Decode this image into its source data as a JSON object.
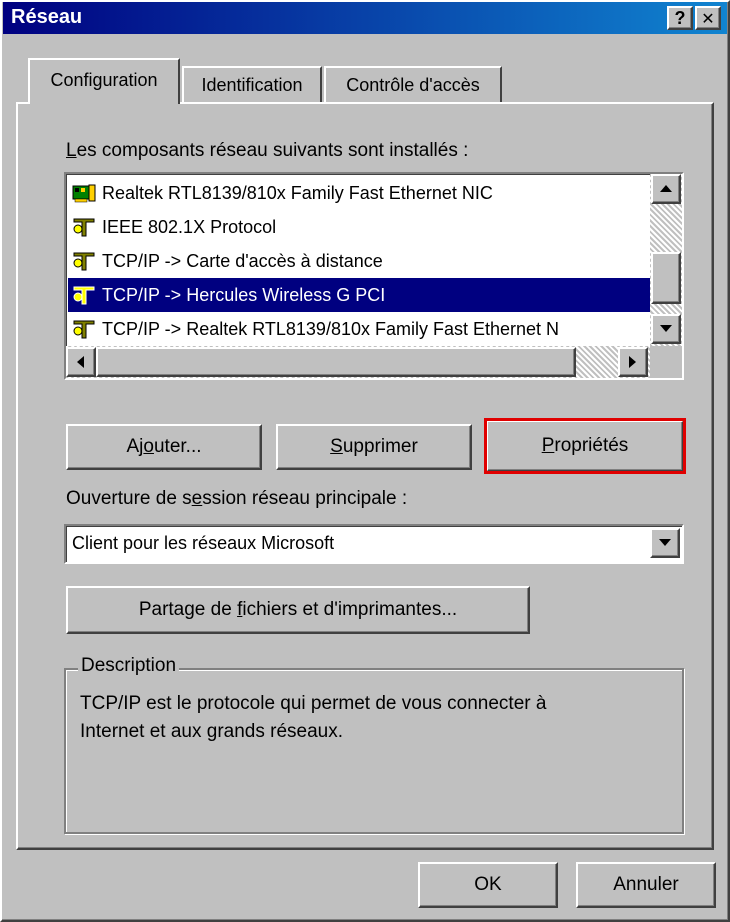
{
  "window": {
    "title": "Réseau",
    "help_btn": "?",
    "close_btn": "✕"
  },
  "tabs": [
    {
      "label": "Configuration",
      "active": true
    },
    {
      "label": "Identification",
      "active": false
    },
    {
      "label": "Contrôle d'accès",
      "active": false
    }
  ],
  "components": {
    "label_prefix": "L",
    "label_rest": "es composants réseau suivants sont installés :",
    "items": [
      {
        "label": "Realtek RTL8139/810x Family Fast Ethernet NIC",
        "icon": "network-card-icon",
        "selected": false
      },
      {
        "label": "IEEE 802.1X Protocol",
        "icon": "protocol-icon",
        "selected": false
      },
      {
        "label": "TCP/IP -> Carte d'accès à distance",
        "icon": "protocol-icon",
        "selected": false
      },
      {
        "label": "TCP/IP -> Hercules Wireless G PCI",
        "icon": "protocol-icon",
        "selected": true
      },
      {
        "label": "TCP/IP -> Realtek RTL8139/810x Family Fast Ethernet N",
        "icon": "protocol-icon",
        "selected": false
      }
    ]
  },
  "buttons": {
    "add_pre": "Aj",
    "add_u": "o",
    "add_post": "uter...",
    "remove_u": "S",
    "remove_post": "upprimer",
    "props_u": "P",
    "props_post": "ropriétés",
    "share_pre": "Partage de ",
    "share_u": "f",
    "share_post": "ichiers et d'imprimantes...",
    "ok": "OK",
    "cancel": "Annuler"
  },
  "logon": {
    "label_pre": "Ouverture de s",
    "label_u": "e",
    "label_post": "ssion réseau principale :",
    "value": "Client pour les réseaux Microsoft"
  },
  "description": {
    "legend": "Description",
    "text_line1": "TCP/IP est le protocole qui permet de vous connecter à",
    "text_line2": "Internet et aux grands réseaux."
  },
  "colors": {
    "highlight_outline": "#e00000",
    "selection": "#000080",
    "title_start": "#000080",
    "title_end": "#1084d0"
  }
}
